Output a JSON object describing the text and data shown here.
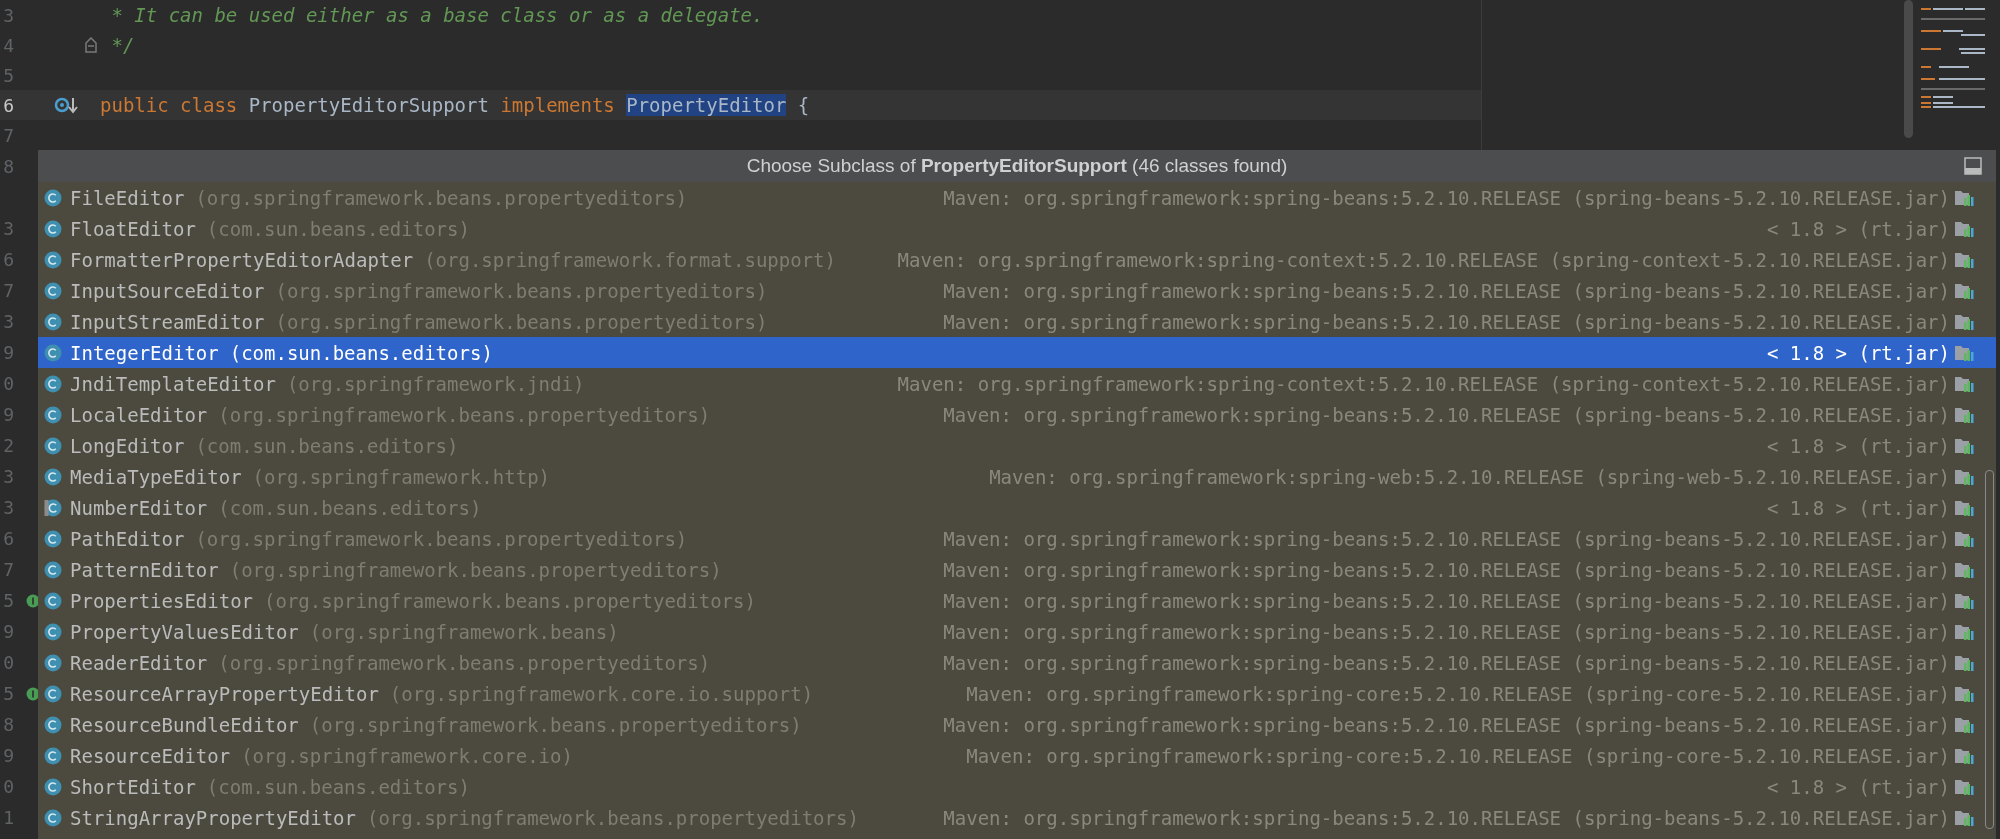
{
  "editor": {
    "lines": [
      {
        "number": "3",
        "current": false,
        "fold_marker": false,
        "implemented_marker": false,
        "tokens": [
          {
            "kind": "comment",
            "text": " * It can be used either as a base class or as a delegate."
          }
        ]
      },
      {
        "number": "4",
        "current": false,
        "fold_marker": true,
        "implemented_marker": false,
        "tokens": [
          {
            "kind": "comment",
            "text": " */"
          }
        ]
      },
      {
        "number": "5",
        "current": false,
        "fold_marker": false,
        "implemented_marker": false
      },
      {
        "number": "6",
        "current": true,
        "fold_marker": false,
        "implemented_marker": true,
        "tokens": [
          {
            "kind": "keyword",
            "text": "public "
          },
          {
            "kind": "keyword",
            "text": "class"
          },
          {
            "kind": "plain",
            "text": " PropertyEditorSupport "
          },
          {
            "kind": "keyword",
            "text": "implements "
          },
          {
            "kind": "selected",
            "text": "PropertyEditor"
          },
          {
            "kind": "plain",
            "text": " {"
          }
        ]
      },
      {
        "number": "7",
        "current": false,
        "fold_marker": false,
        "implemented_marker": false
      }
    ],
    "covered_lines": [
      {
        "number": "8",
        "marker": false
      },
      {
        "marker": false
      },
      {
        "number": "3",
        "marker": false
      },
      {
        "number": "6",
        "marker": false
      },
      {
        "number": "7",
        "marker": false
      },
      {
        "number": "3",
        "marker": false
      },
      {
        "number": "9",
        "marker": false
      },
      {
        "number": "0",
        "marker": false
      },
      {
        "number": "9",
        "marker": false
      },
      {
        "number": "2",
        "marker": false
      },
      {
        "number": "3",
        "marker": false
      },
      {
        "number": "3",
        "marker": false
      },
      {
        "number": "6",
        "marker": false
      },
      {
        "number": "7",
        "marker": false
      },
      {
        "number": "5",
        "marker": true
      },
      {
        "number": "9",
        "marker": false
      },
      {
        "number": "0",
        "marker": false
      },
      {
        "number": "5",
        "marker": true
      },
      {
        "number": "8",
        "marker": false
      },
      {
        "number": "9",
        "marker": false
      },
      {
        "number": "0",
        "marker": false
      },
      {
        "number": "1",
        "marker": false
      }
    ]
  },
  "popup": {
    "title": "Choose Subclass of **PropertyEditorSupport** (46 classes found)",
    "rows": [
      {
        "kind": "class",
        "name": "FileEditor",
        "package": "(org.springframework.beans.propertyeditors)",
        "location": "Maven: org.springframework:spring-beans:5.2.10.RELEASE (spring-beans-5.2.10.RELEASE.jar)",
        "selected": false
      },
      {
        "kind": "class",
        "name": "FloatEditor",
        "package": "(com.sun.beans.editors)",
        "location": "< 1.8 > (rt.jar)",
        "selected": false
      },
      {
        "kind": "class",
        "name": "FormatterPropertyEditorAdapter",
        "package": "(org.springframework.format.support)",
        "location": "Maven: org.springframework:spring-context:5.2.10.RELEASE (spring-context-5.2.10.RELEASE.jar)",
        "selected": false
      },
      {
        "kind": "class",
        "name": "InputSourceEditor",
        "package": "(org.springframework.beans.propertyeditors)",
        "location": "Maven: org.springframework:spring-beans:5.2.10.RELEASE (spring-beans-5.2.10.RELEASE.jar)",
        "selected": false
      },
      {
        "kind": "class",
        "name": "InputStreamEditor",
        "package": "(org.springframework.beans.propertyeditors)",
        "location": "Maven: org.springframework:spring-beans:5.2.10.RELEASE (spring-beans-5.2.10.RELEASE.jar)",
        "selected": false
      },
      {
        "kind": "class",
        "name": "IntegerEditor",
        "package": "(com.sun.beans.editors)",
        "location": "< 1.8 > (rt.jar)",
        "selected": true
      },
      {
        "kind": "class",
        "name": "JndiTemplateEditor",
        "package": "(org.springframework.jndi)",
        "location": "Maven: org.springframework:spring-context:5.2.10.RELEASE (spring-context-5.2.10.RELEASE.jar)",
        "selected": false
      },
      {
        "kind": "class",
        "name": "LocaleEditor",
        "package": "(org.springframework.beans.propertyeditors)",
        "location": "Maven: org.springframework:spring-beans:5.2.10.RELEASE (spring-beans-5.2.10.RELEASE.jar)",
        "selected": false
      },
      {
        "kind": "class",
        "name": "LongEditor",
        "package": "(com.sun.beans.editors)",
        "location": "< 1.8 > (rt.jar)",
        "selected": false
      },
      {
        "kind": "class",
        "name": "MediaTypeEditor",
        "package": "(org.springframework.http)",
        "location": "Maven: org.springframework:spring-web:5.2.10.RELEASE (spring-web-5.2.10.RELEASE.jar)",
        "selected": false
      },
      {
        "kind": "abstract",
        "name": "NumberEditor",
        "package": "(com.sun.beans.editors)",
        "location": "< 1.8 > (rt.jar)",
        "selected": false
      },
      {
        "kind": "class",
        "name": "PathEditor",
        "package": "(org.springframework.beans.propertyeditors)",
        "location": "Maven: org.springframework:spring-beans:5.2.10.RELEASE (spring-beans-5.2.10.RELEASE.jar)",
        "selected": false
      },
      {
        "kind": "class",
        "name": "PatternEditor",
        "package": "(org.springframework.beans.propertyeditors)",
        "location": "Maven: org.springframework:spring-beans:5.2.10.RELEASE (spring-beans-5.2.10.RELEASE.jar)",
        "selected": false
      },
      {
        "kind": "class",
        "name": "PropertiesEditor",
        "package": "(org.springframework.beans.propertyeditors)",
        "location": "Maven: org.springframework:spring-beans:5.2.10.RELEASE (spring-beans-5.2.10.RELEASE.jar)",
        "selected": false
      },
      {
        "kind": "class",
        "name": "PropertyValuesEditor",
        "package": "(org.springframework.beans)",
        "location": "Maven: org.springframework:spring-beans:5.2.10.RELEASE (spring-beans-5.2.10.RELEASE.jar)",
        "selected": false
      },
      {
        "kind": "class",
        "name": "ReaderEditor",
        "package": "(org.springframework.beans.propertyeditors)",
        "location": "Maven: org.springframework:spring-beans:5.2.10.RELEASE (spring-beans-5.2.10.RELEASE.jar)",
        "selected": false
      },
      {
        "kind": "class",
        "name": "ResourceArrayPropertyEditor",
        "package": "(org.springframework.core.io.support)",
        "location": "Maven: org.springframework:spring-core:5.2.10.RELEASE (spring-core-5.2.10.RELEASE.jar)",
        "selected": false
      },
      {
        "kind": "class",
        "name": "ResourceBundleEditor",
        "package": "(org.springframework.beans.propertyeditors)",
        "location": "Maven: org.springframework:spring-beans:5.2.10.RELEASE (spring-beans-5.2.10.RELEASE.jar)",
        "selected": false
      },
      {
        "kind": "class",
        "name": "ResourceEditor",
        "package": "(org.springframework.core.io)",
        "location": "Maven: org.springframework:spring-core:5.2.10.RELEASE (spring-core-5.2.10.RELEASE.jar)",
        "selected": false
      },
      {
        "kind": "class",
        "name": "ShortEditor",
        "package": "(com.sun.beans.editors)",
        "location": "< 1.8 > (rt.jar)",
        "selected": false
      },
      {
        "kind": "class",
        "name": "StringArrayPropertyEditor",
        "package": "(org.springframework.beans.propertyeditors)",
        "location": "Maven: org.springframework:spring-beans:5.2.10.RELEASE (spring-beans-5.2.10.RELEASE.jar)",
        "selected": false
      }
    ]
  }
}
